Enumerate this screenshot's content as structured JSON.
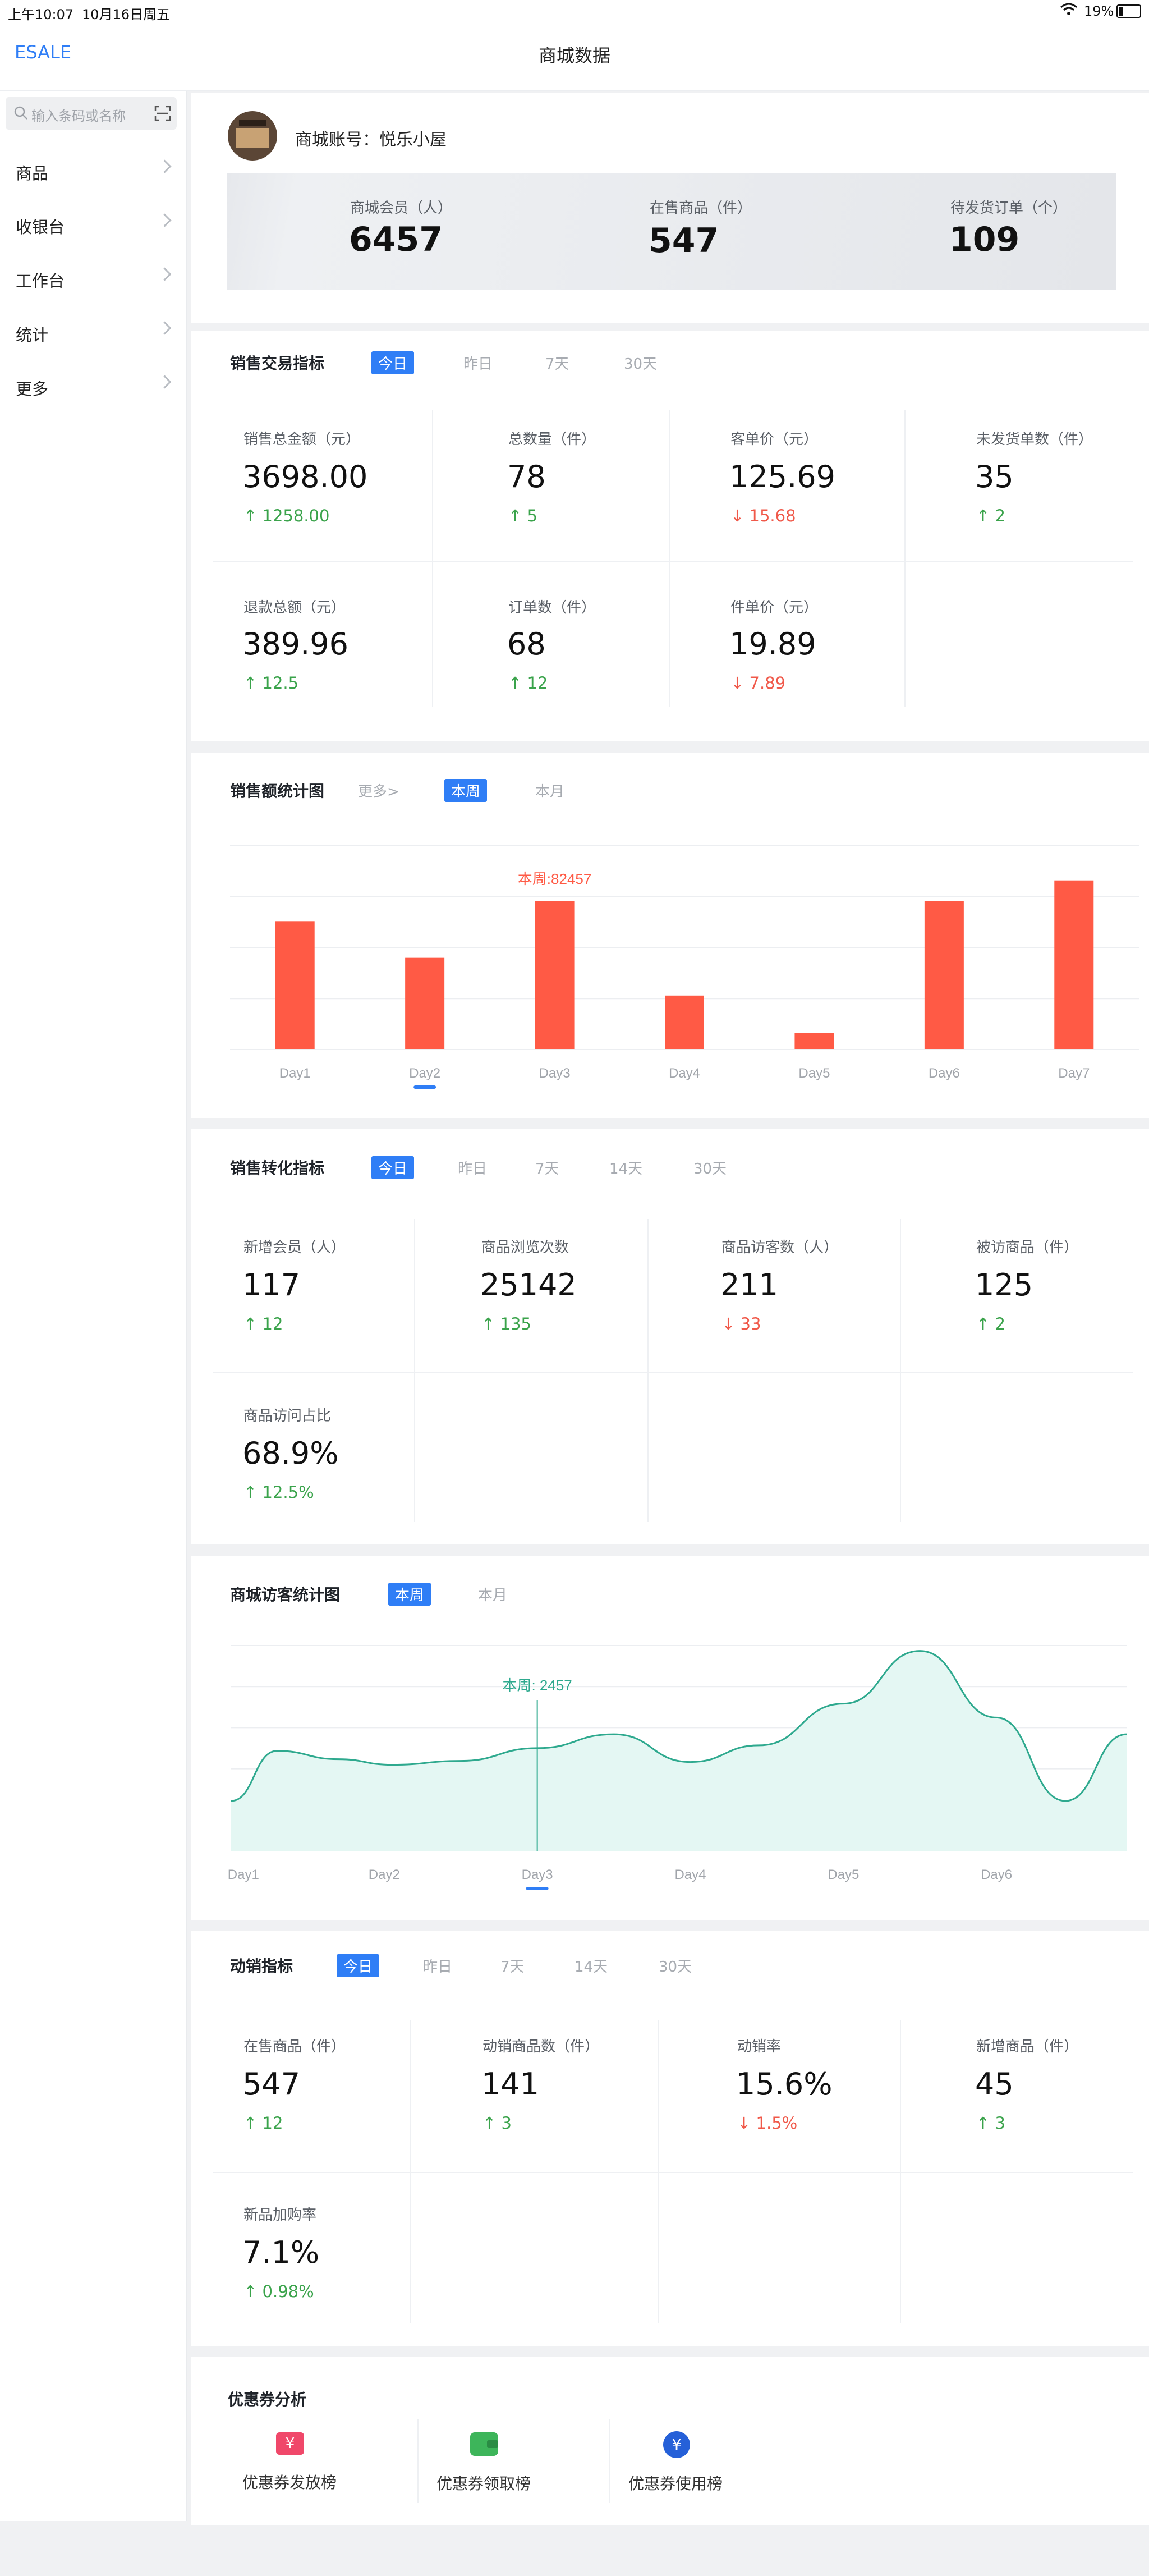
{
  "status": {
    "time": "上午10:07",
    "date": "10月16日周五",
    "battery": "19%"
  },
  "nav": {
    "left": "ESALE",
    "title": "商城数据"
  },
  "sidebar": {
    "search_placeholder": "输入条码或名称",
    "items": [
      {
        "label": "商品"
      },
      {
        "label": "收银台"
      },
      {
        "label": "工作台"
      },
      {
        "label": "统计"
      },
      {
        "label": "更多"
      }
    ]
  },
  "account": {
    "name": "商城账号：悦乐小屋",
    "stats": [
      {
        "label": "商城会员（人）",
        "value": "6457"
      },
      {
        "label": "在售商品（件）",
        "value": "547"
      },
      {
        "label": "待发货订单（个）",
        "value": "109"
      }
    ]
  },
  "sales_trade": {
    "title": "销售交易指标",
    "tabs": [
      "今日",
      "昨日",
      "7天",
      "30天"
    ],
    "metrics": [
      {
        "label": "销售总金额（元）",
        "value": "3698.00",
        "delta": "1258.00",
        "dir": "up"
      },
      {
        "label": "总数量（件）",
        "value": "78",
        "delta": "5",
        "dir": "up"
      },
      {
        "label": "客单价（元）",
        "value": "125.69",
        "delta": "15.68",
        "dir": "down"
      },
      {
        "label": "未发货单数（件）",
        "value": "35",
        "delta": "2",
        "dir": "up"
      },
      {
        "label": "退款总额（元）",
        "value": "389.96",
        "delta": "12.5",
        "dir": "up"
      },
      {
        "label": "订单数（件）",
        "value": "68",
        "delta": "12",
        "dir": "up"
      },
      {
        "label": "件单价（元）",
        "value": "19.89",
        "delta": "7.89",
        "dir": "down"
      }
    ]
  },
  "sales_chart": {
    "title": "销售额统计图",
    "more": "更多>",
    "tabs": [
      "本周",
      "本月"
    ],
    "tooltip": "本周:82457"
  },
  "chart_data": [
    {
      "type": "bar",
      "categories": [
        "Day1",
        "Day2",
        "Day3",
        "Day4",
        "Day5",
        "Day6",
        "Day7"
      ],
      "values": [
        63000,
        45000,
        73000,
        26500,
        8000,
        73000,
        83000
      ],
      "highlight_index": 1,
      "highlight_label": "本周:82457",
      "ylim": [
        0,
        100000
      ],
      "color": "#ff5a45",
      "grid": true
    },
    {
      "type": "area",
      "categories": [
        "Day1",
        "Day2",
        "Day3",
        "Day4",
        "Day5",
        "Day6"
      ],
      "x": [
        0,
        0.3,
        0.7,
        1.05,
        1.5,
        2.0,
        2.5,
        3.0,
        3.45,
        4.0,
        4.5,
        5.0,
        5.45,
        5.85
      ],
      "values": [
        900,
        1800,
        1650,
        1550,
        1620,
        1850,
        2100,
        1600,
        1900,
        2650,
        3600,
        2400,
        900,
        2100
      ],
      "highlight_label": "本周: 2457",
      "highlight_index": 2,
      "ylim": [
        0,
        4000
      ],
      "color": "#2ea98e",
      "fill": "#e4f7f3",
      "grid": true
    }
  ],
  "conversion": {
    "title": "销售转化指标",
    "tabs": [
      "今日",
      "昨日",
      "7天",
      "14天",
      "30天"
    ],
    "metrics": [
      {
        "label": "新增会员（人）",
        "value": "117",
        "delta": "12",
        "dir": "up"
      },
      {
        "label": "商品浏览次数",
        "value": "25142",
        "delta": "135",
        "dir": "up"
      },
      {
        "label": "商品访客数（人）",
        "value": "211",
        "delta": "33",
        "dir": "down"
      },
      {
        "label": "被访商品（件）",
        "value": "125",
        "delta": "2",
        "dir": "up"
      },
      {
        "label": "商品访问占比",
        "value": "68.9%",
        "delta": "12.5%",
        "dir": "up"
      }
    ]
  },
  "visitor_chart": {
    "title": "商城访客统计图",
    "tabs": [
      "本周",
      "本月"
    ]
  },
  "movement": {
    "title": "动销指标",
    "tabs": [
      "今日",
      "昨日",
      "7天",
      "14天",
      "30天"
    ],
    "metrics": [
      {
        "label": "在售商品（件）",
        "value": "547",
        "delta": "12",
        "dir": "up"
      },
      {
        "label": "动销商品数（件）",
        "value": "141",
        "delta": "3",
        "dir": "up"
      },
      {
        "label": "动销率",
        "value": "15.6%",
        "delta": "1.5%",
        "dir": "down"
      },
      {
        "label": "新增商品（件）",
        "value": "45",
        "delta": "3",
        "dir": "up"
      },
      {
        "label": "新品加购率",
        "value": "7.1%",
        "delta": "0.98%",
        "dir": "up"
      }
    ]
  },
  "coupon": {
    "title": "优惠券分析",
    "items": [
      {
        "label": "优惠券发放榜",
        "icon": "coupon-ticket-icon",
        "glyph": "¥",
        "color": "#f0486a"
      },
      {
        "label": "优惠券领取榜",
        "icon": "wallet-icon",
        "glyph": "",
        "color": "#3db55a"
      },
      {
        "label": "优惠券使用榜",
        "icon": "yen-circle-icon",
        "glyph": "¥",
        "color": "#2560d8"
      }
    ]
  },
  "arrows": {
    "up": "↑",
    "down": "↓"
  }
}
